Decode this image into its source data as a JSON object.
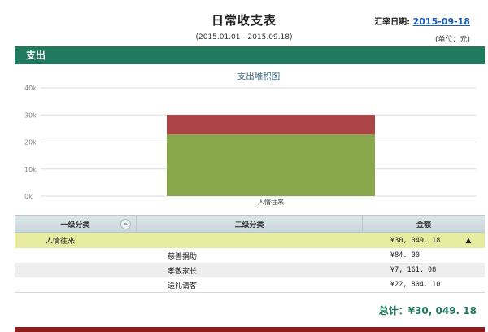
{
  "header": {
    "title": "日常收支表",
    "date_label": "汇率日期:",
    "date_value": "2015-09-18",
    "period": "(2015.01.01 - 2015.09.18)",
    "unit": "(单位：元)"
  },
  "sections": {
    "expense_label": "支出",
    "income_label": ""
  },
  "colors": {
    "expense_bar": "#1f7a5e",
    "income_bar": "#8e1d1d",
    "series_green": "#88a74d",
    "series_red": "#ac4446"
  },
  "chart_data": {
    "type": "bar",
    "title": "支出堆积图",
    "stacked": true,
    "categories": [
      "人情往来"
    ],
    "series": [
      {
        "values": [
          22804.1
        ],
        "color": "#88a74d"
      },
      {
        "values": [
          7245.08
        ],
        "color": "#ac4446"
      }
    ],
    "ylim": [
      0,
      40000
    ],
    "yticks": [
      "0k",
      "10k",
      "20k",
      "30k",
      "40k"
    ],
    "ytick_values": [
      0,
      10000,
      20000,
      30000,
      40000
    ],
    "grid": true,
    "xlabel": "",
    "ylabel": ""
  },
  "table": {
    "headers": [
      "一级分类",
      "二级分类",
      "金额"
    ],
    "group": {
      "name": "人情往来",
      "amount": "¥30, 049. 18"
    },
    "rows": [
      {
        "sub": "慈善捐助",
        "amount": "¥84. 00"
      },
      {
        "sub": "孝敬家长",
        "amount": "¥7, 161. 08"
      },
      {
        "sub": "送礼请客",
        "amount": "¥22, 804. 10"
      }
    ]
  },
  "total": "总计：¥30, 049. 18",
  "icons": {
    "sort": "chevron-double-down-icon",
    "collapse": "caret-up-icon"
  }
}
